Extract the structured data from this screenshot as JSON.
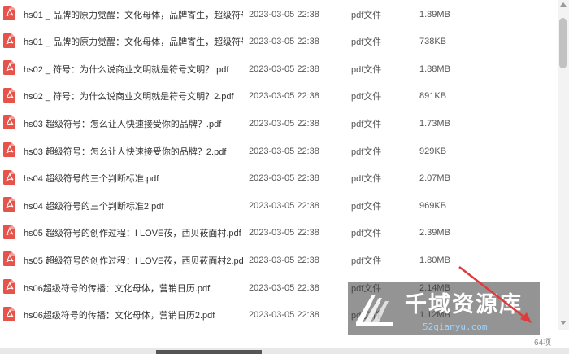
{
  "files": [
    {
      "name": "hs01 _ 品牌的原力觉醒：文化母体，品牌寄生，超级符号...",
      "date": "2023-03-05 22:38",
      "type": "pdf文件",
      "size": "1.89MB"
    },
    {
      "name": "hs01 _ 品牌的原力觉醒：文化母体，品牌寄生，超级符号...",
      "date": "2023-03-05 22:38",
      "type": "pdf文件",
      "size": "738KB"
    },
    {
      "name": "hs02 _ 符号：为什么说商业文明就是符号文明？.pdf",
      "date": "2023-03-05 22:38",
      "type": "pdf文件",
      "size": "1.88MB"
    },
    {
      "name": "hs02 _ 符号：为什么说商业文明就是符号文明？2.pdf",
      "date": "2023-03-05 22:38",
      "type": "pdf文件",
      "size": "891KB"
    },
    {
      "name": "hs03  超级符号：怎么让人快速接受你的品牌？.pdf",
      "date": "2023-03-05 22:38",
      "type": "pdf文件",
      "size": "1.73MB"
    },
    {
      "name": "hs03  超级符号：怎么让人快速接受你的品牌？2.pdf",
      "date": "2023-03-05 22:38",
      "type": "pdf文件",
      "size": "929KB"
    },
    {
      "name": "hs04  超级符号的三个判断标准.pdf",
      "date": "2023-03-05 22:38",
      "type": "pdf文件",
      "size": "2.07MB"
    },
    {
      "name": "hs04  超级符号的三个判断标准2.pdf",
      "date": "2023-03-05 22:38",
      "type": "pdf文件",
      "size": "969KB"
    },
    {
      "name": "hs05  超级符号的创作过程：I LOVE莜，西贝莜面村.pdf",
      "date": "2023-03-05 22:38",
      "type": "pdf文件",
      "size": "2.39MB"
    },
    {
      "name": "hs05  超级符号的创作过程：I LOVE莜，西贝莜面村2.pdf",
      "date": "2023-03-05 22:38",
      "type": "pdf文件",
      "size": "1.80MB"
    },
    {
      "name": "hs06超级符号的传播：文化母体，营销日历.pdf",
      "date": "2023-03-05 22:38",
      "type": "pdf文件",
      "size": "2.14MB"
    },
    {
      "name": "hs06超级符号的传播：文化母体，营销日历2.pdf",
      "date": "2023-03-05 22:38",
      "type": "pdf文件",
      "size": "1.12MB"
    }
  ],
  "footer": {
    "count": "64项"
  },
  "watermark": {
    "text": "千域资源库",
    "domain": "52qianyu.com"
  },
  "colors": {
    "pdf_icon": "#e5534b",
    "arrow": "#e03a3a"
  },
  "icons": {
    "file": "pdf-file-icon"
  }
}
